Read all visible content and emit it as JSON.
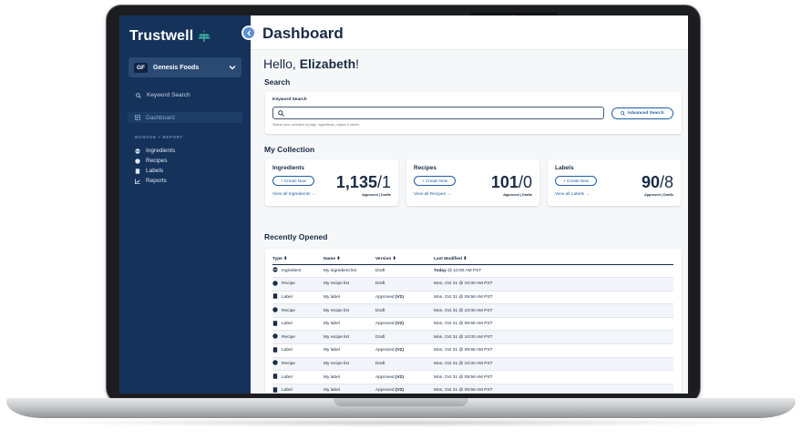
{
  "brand": {
    "name": "Trustwell"
  },
  "org": {
    "badge": "GF",
    "name": "Genesis Foods"
  },
  "sidebar": {
    "search_label": "Keyword Search",
    "dashboard_label": "Dashboard",
    "section_label": "MANAGE + REPORT",
    "items": [
      {
        "label": "Ingredients",
        "icon": "ingredient-icon"
      },
      {
        "label": "Recipes",
        "icon": "recipe-icon"
      },
      {
        "label": "Labels",
        "icon": "label-icon"
      },
      {
        "label": "Reports",
        "icon": "chart-icon"
      }
    ]
  },
  "header": {
    "title": "Dashboard"
  },
  "greeting": {
    "prefix": "Hello, ",
    "name": "Elizabeth",
    "suffix": "!"
  },
  "search": {
    "title": "Search",
    "label": "Keyword Search",
    "help": "Search your collection by tags, ingredients, recipes & labels",
    "advanced_label": "Advanced Search"
  },
  "collection": {
    "title": "My Collection",
    "cards": [
      {
        "title": "Ingredients",
        "create": "+ Create New",
        "view_all": "View all Ingredients →",
        "approved": "1,135",
        "drafts": "1",
        "sub": "Approved | Drafts"
      },
      {
        "title": "Recipes",
        "create": "+ Create New",
        "view_all": "View all Recipes →",
        "approved": "101",
        "drafts": "0",
        "sub": "Approved | Drafts"
      },
      {
        "title": "Labels",
        "create": "+ Create New",
        "view_all": "View all Labels →",
        "approved": "90",
        "drafts": "8",
        "sub": "Approved | Drafts"
      }
    ]
  },
  "recent": {
    "title": "Recently Opened",
    "columns": [
      "Type ⬍",
      "Name ⬍",
      "Version ⬍",
      "Last Modified ⬍"
    ],
    "rows": [
      {
        "type": "Ingredient",
        "icon": "ingredient-icon",
        "name": "My ingredient list",
        "version": "Draft",
        "version_bold": "",
        "modified_bold": "Today",
        "modified": " @ 10:00 AM PST"
      },
      {
        "type": "Recipe",
        "icon": "recipe-icon",
        "name": "My recipe list",
        "version": "Draft",
        "version_bold": "",
        "modified_bold": "",
        "modified": "Mon, Oct 31 @ 10:00 AM PST"
      },
      {
        "type": "Label",
        "icon": "label-icon",
        "name": "My label",
        "version": "Approved ",
        "version_bold": "(V2)",
        "modified_bold": "",
        "modified": "Mon, Oct 31 @ 09:58 AM PST"
      },
      {
        "type": "Recipe",
        "icon": "recipe-icon",
        "name": "My recipe list",
        "version": "Draft",
        "version_bold": "",
        "modified_bold": "",
        "modified": "Mon, Oct 31 @ 10:00 AM PST"
      },
      {
        "type": "Label",
        "icon": "label-icon",
        "name": "My label",
        "version": "Approved ",
        "version_bold": "(V2)",
        "modified_bold": "",
        "modified": "Mon, Oct 31 @ 09:58 AM PST"
      },
      {
        "type": "Recipe",
        "icon": "recipe-icon",
        "name": "My recipe list",
        "version": "Draft",
        "version_bold": "",
        "modified_bold": "",
        "modified": "Mon, Oct 31 @ 10:00 AM PST"
      },
      {
        "type": "Label",
        "icon": "label-icon",
        "name": "My label",
        "version": "Approved ",
        "version_bold": "(V2)",
        "modified_bold": "",
        "modified": "Mon, Oct 31 @ 09:58 AM PST"
      },
      {
        "type": "Recipe",
        "icon": "recipe-icon",
        "name": "My recipe list",
        "version": "Draft",
        "version_bold": "",
        "modified_bold": "",
        "modified": "Mon, Oct 31 @ 10:00 AM PST"
      },
      {
        "type": "Label",
        "icon": "label-icon",
        "name": "My label",
        "version": "Approved ",
        "version_bold": "(V2)",
        "modified_bold": "",
        "modified": "Mon, Oct 31 @ 09:58 AM PST"
      },
      {
        "type": "Label",
        "icon": "label-icon",
        "name": "My label",
        "version": "Approved ",
        "version_bold": "(V2)",
        "modified_bold": "",
        "modified": "Mon, Oct 31 @ 09:58 AM PST"
      }
    ]
  },
  "colors": {
    "sidebar": "#14325a",
    "accent": "#1f5ea8",
    "text": "#1a2b44"
  }
}
